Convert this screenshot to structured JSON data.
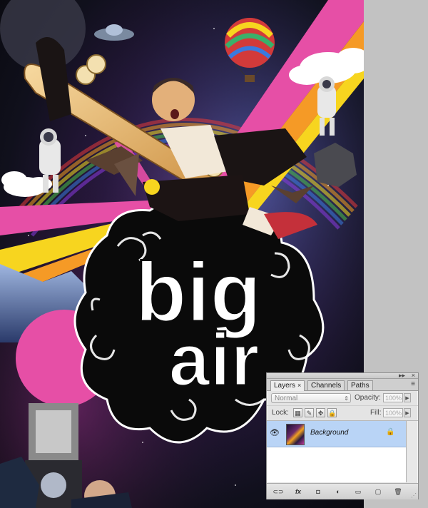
{
  "artwork": {
    "title_line1": "big",
    "title_line2": "air",
    "colors": {
      "pink": "#e64fa6",
      "orange": "#f59a26",
      "yellow": "#f7d51f",
      "space_dark": "#10101c",
      "skateboard": "#e6b25a",
      "cloud": "#ffffff"
    }
  },
  "layers_panel": {
    "tabs": [
      {
        "label": "Layers",
        "close": "×"
      },
      {
        "label": "Channels"
      },
      {
        "label": "Paths"
      }
    ],
    "menu_icon": "≡",
    "blend_mode": "Normal",
    "opacity_label": "Opacity:",
    "opacity_value": "100%",
    "lock_label": "Lock:",
    "fill_label": "Fill:",
    "fill_value": "100%",
    "layers": [
      {
        "name": "Background",
        "visible": true,
        "locked": true
      }
    ],
    "footer_buttons": [
      {
        "name": "link-layers-icon",
        "glyph": "⊂⊃"
      },
      {
        "name": "fx-icon",
        "glyph": "fx"
      },
      {
        "name": "mask-icon",
        "glyph": "◘"
      },
      {
        "name": "adjustment-layer-icon",
        "glyph": "◐"
      },
      {
        "name": "new-group-icon",
        "glyph": "▭"
      },
      {
        "name": "new-layer-icon",
        "glyph": "▢"
      },
      {
        "name": "trash-icon",
        "glyph": "🗑"
      }
    ]
  }
}
